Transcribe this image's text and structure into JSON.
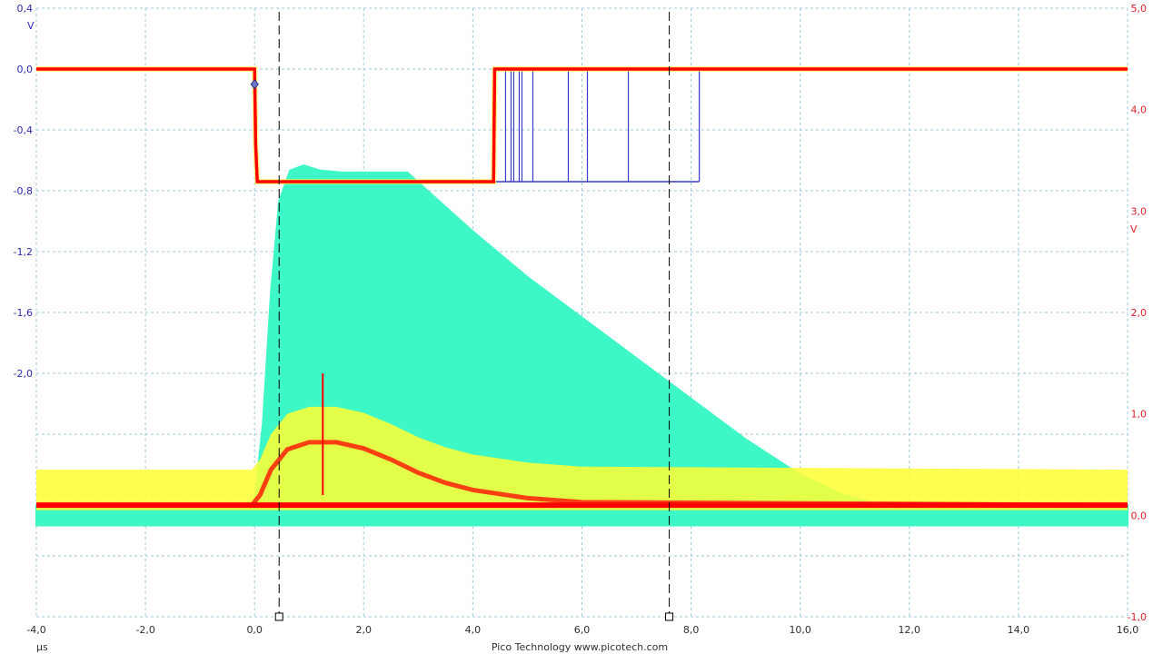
{
  "footer": "Pico Technology   www.picotech.com",
  "colors": {
    "grid": "#9ec9d6",
    "channel_a": "#3a3ac8",
    "channel_b_fill": "#3ef7c6",
    "persistence_hot": "#ff0000",
    "persistence_warm": "#ffff33",
    "cursor": "#000000"
  },
  "chart_data": {
    "type": "line",
    "title": "",
    "x_unit": "µs",
    "xlim": [
      -4.0,
      16.0
    ],
    "x_ticks": [
      "-4,0",
      "-2,0",
      "0,0",
      "2,0",
      "4,0",
      "6,0",
      "8,0",
      "10,0",
      "12,0",
      "14,0",
      "16,0"
    ],
    "y_left": {
      "unit": "V",
      "lim": [
        -3.6,
        0.4
      ],
      "ticks": [
        {
          "value": 0.4,
          "label": "0,4"
        },
        {
          "value": 0.0,
          "label": "0,0"
        },
        {
          "value": -0.4,
          "label": "-0,4"
        },
        {
          "value": -0.8,
          "label": "-0,8"
        },
        {
          "value": -1.2,
          "label": "-1,2"
        },
        {
          "value": -1.6,
          "label": "-1,6"
        },
        {
          "value": -2.0,
          "label": "-2,0"
        }
      ]
    },
    "y_right": {
      "unit": "V",
      "lim": [
        -1.0,
        5.0
      ],
      "ticks": [
        {
          "value": 5.0,
          "label": "5,0"
        },
        {
          "value": 4.0,
          "label": "4,0"
        },
        {
          "value": 3.0,
          "label": "3,0"
        },
        {
          "value": 2.0,
          "label": "2,0"
        },
        {
          "value": 1.0,
          "label": "1,0"
        },
        {
          "value": 0.0,
          "label": "0,0"
        },
        {
          "value": -1.0,
          "label": "-1,0"
        }
      ]
    },
    "cursors_x": [
      0.45,
      7.6
    ],
    "trigger_marker": {
      "x": 0.0,
      "y": -0.1
    },
    "series": [
      {
        "axis": "left",
        "x": [
          -4.0,
          0.0,
          0.02,
          0.05,
          4.35,
          4.38,
          4.4,
          16.0
        ],
        "y": [
          0.0,
          0.0,
          -0.5,
          -0.74,
          -0.74,
          -0.74,
          0.0,
          0.0
        ]
      },
      {
        "axis": "left",
        "x": [
          4.4,
          4.6,
          4.7,
          4.75,
          4.85,
          4.9,
          5.1,
          5.75,
          6.1,
          6.85,
          8.15
        ],
        "y": [
          -0.74,
          -0.74,
          -0.74,
          -0.74,
          -0.74,
          -0.74,
          -0.74,
          -0.74,
          -0.74,
          -0.74,
          -0.74
        ]
      },
      {
        "axis": "right",
        "x": [
          -4.0,
          -0.05,
          0.0,
          0.15,
          0.3,
          0.45,
          0.65,
          0.9,
          1.2,
          1.6,
          2.0,
          2.8,
          4.0,
          5.0,
          6.0,
          7.0,
          8.0,
          9.0,
          10.0,
          10.8,
          11.5,
          16.0
        ],
        "y": [
          0.1,
          0.1,
          0.15,
          0.9,
          2.2,
          3.1,
          3.4,
          3.45,
          3.4,
          3.38,
          3.38,
          3.38,
          2.8,
          2.35,
          1.95,
          1.55,
          1.15,
          0.75,
          0.4,
          0.2,
          0.1,
          0.1
        ]
      },
      {
        "axis": "right",
        "x": [
          -4.0,
          -0.05,
          0.1,
          0.3,
          0.6,
          1.0,
          1.5,
          2.0,
          2.5,
          3.0,
          3.5,
          4.0,
          5.0,
          6.0,
          16.0
        ],
        "y": [
          0.1,
          0.1,
          0.2,
          0.45,
          0.65,
          0.72,
          0.72,
          0.66,
          0.55,
          0.42,
          0.32,
          0.25,
          0.17,
          0.13,
          0.1
        ]
      }
    ]
  }
}
